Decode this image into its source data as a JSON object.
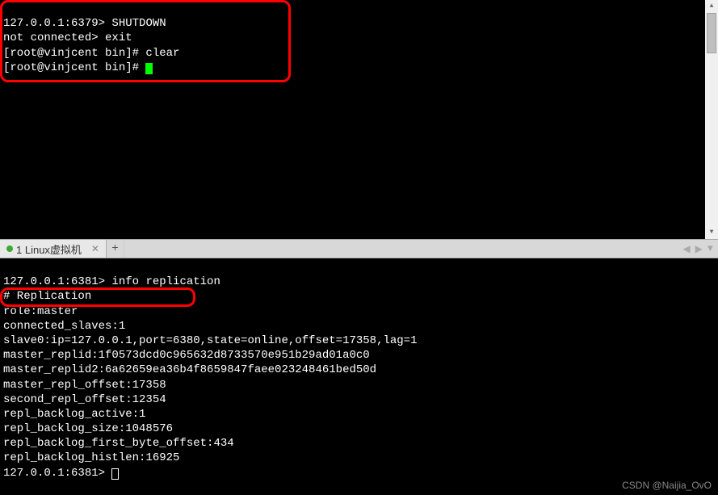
{
  "top_terminal": {
    "line1_prompt": "127.0.0.1:6379>",
    "line1_cmd": " SHUTDOWN",
    "line2_prompt": "not connected>",
    "line2_cmd": " exit",
    "line3_prompt": "[root@vinjcent bin]#",
    "line3_cmd": " clear",
    "line4_prompt": "[root@vinjcent bin]# "
  },
  "tab": {
    "label": "1 Linux虚拟机",
    "close": "✕",
    "add": "+"
  },
  "bottom_terminal": {
    "line1_prompt": "127.0.0.1:6381>",
    "line1_cmd": " info replication",
    "lines": [
      "# Replication",
      "role:master",
      "connected_slaves:1",
      "slave0:ip=127.0.0.1,port=6380,state=online,offset=17358,lag=1",
      "master_replid:1f0573dcd0c965632d8733570e951b29ad01a0c0",
      "master_replid2:6a62659ea36b4f8659847faee023248461bed50d",
      "master_repl_offset:17358",
      "second_repl_offset:12354",
      "repl_backlog_active:1",
      "repl_backlog_size:1048576",
      "repl_backlog_first_byte_offset:434",
      "repl_backlog_histlen:16925"
    ],
    "last_prompt": "127.0.0.1:6381> "
  },
  "watermark": "CSDN @Naijia_OvO"
}
